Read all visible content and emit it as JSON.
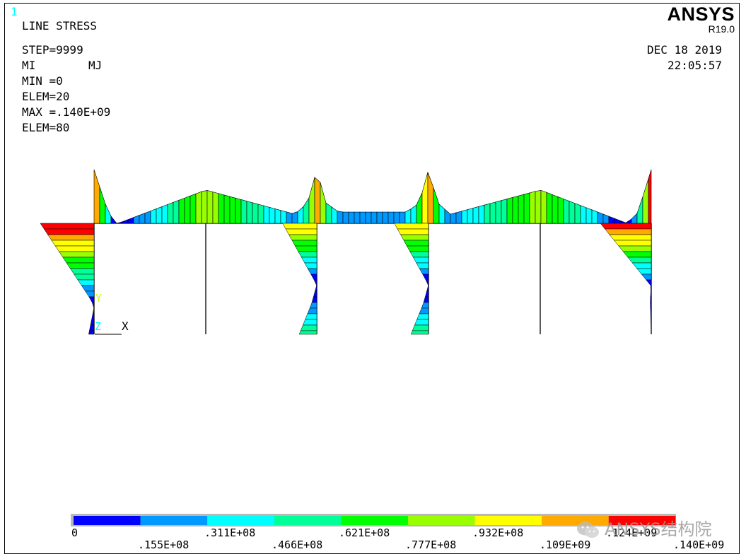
{
  "window_number": "1",
  "header": {
    "plot_title": "LINE STRESS",
    "step": "STEP=9999",
    "mi_label": "MI",
    "mj_label": "MJ",
    "min_value": "MIN =0",
    "min_elem": "ELEM=20",
    "max_value": "MAX =.140E+09",
    "max_elem": "ELEM=80",
    "date": "DEC 18 2019",
    "time": "22:05:57"
  },
  "brand": {
    "name": "ANSYS",
    "version": "R19.0"
  },
  "triad": {
    "y_label": "Y",
    "z_label": "Z",
    "x_label": "X"
  },
  "colors": {
    "contour": [
      "#0000ff",
      "#0099ff",
      "#00ffff",
      "#00ff99",
      "#00ff00",
      "#99ff00",
      "#ffff00",
      "#ffaa00",
      "#ff0000"
    ],
    "triad_y": "#c8ff00",
    "triad_z": "#00ffff",
    "window_number": "#00ffff"
  },
  "legend": {
    "top_labels": [
      "0",
      ".311E+08",
      ".621E+08",
      ".932E+08",
      ".124E+09"
    ],
    "bottom_labels": [
      ".155E+08",
      ".466E+08",
      ".777E+08",
      ".109E+09",
      ".140E+09"
    ]
  },
  "watermark": {
    "text": "ANSYS结构院",
    "icon": "wechat-icon"
  }
}
